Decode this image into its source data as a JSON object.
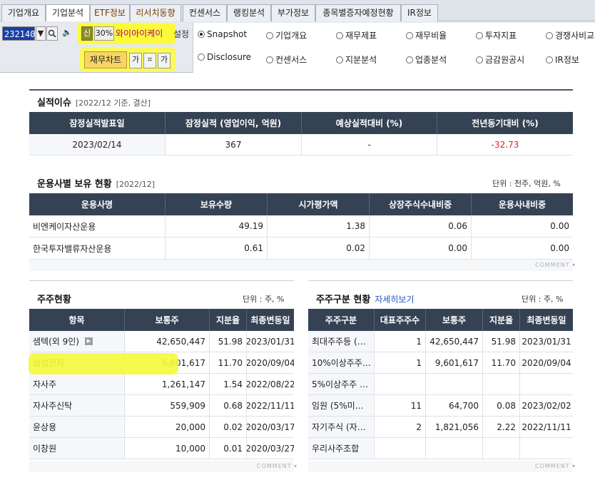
{
  "tabs": [
    {
      "label": "기업개요"
    },
    {
      "label": "기업분석"
    },
    {
      "label": "ETF정보"
    },
    {
      "label": "리서치동향"
    },
    {
      "label": "컨센서스"
    },
    {
      "label": "랭킹분석"
    },
    {
      "label": "부가정보"
    },
    {
      "label": "종목별증자예정현황"
    },
    {
      "label": "IR정보"
    }
  ],
  "toolbar": {
    "stock_code": "232140",
    "credit_badge": "신",
    "margin_rate": "30%",
    "stock_name": "와이아이케이",
    "settings_label": "설정",
    "finance_chart_label": "재무차트",
    "font_up_label": "가",
    "font_down_label": "가"
  },
  "radio_options": [
    {
      "label": "Snapshot",
      "selected": true
    },
    {
      "label": "기업개요",
      "selected": false
    },
    {
      "label": "재무제표",
      "selected": false
    },
    {
      "label": "재무비율",
      "selected": false
    },
    {
      "label": "투자지표",
      "selected": false
    },
    {
      "label": "경쟁사비교",
      "selected": false
    },
    {
      "label": "Disclosure",
      "selected": false
    },
    {
      "label": "컨센서스",
      "selected": false
    },
    {
      "label": "지분분석",
      "selected": false
    },
    {
      "label": "업종분석",
      "selected": false
    },
    {
      "label": "금감원공시",
      "selected": false
    },
    {
      "label": "IR정보",
      "selected": false
    }
  ],
  "earnings": {
    "title": "실적이슈",
    "subtitle": "[2022/12 기준, 결산]",
    "headers": [
      "잠정실적발표일",
      "잠정실적 (영업이익, 억원)",
      "예상실적대비 (%)",
      "전년동기대비 (%)"
    ],
    "row": [
      "2023/02/14",
      "367",
      "-",
      "-32.73"
    ]
  },
  "fund_holdings": {
    "title": "운용사별 보유 현황",
    "subtitle": "[2022/12]",
    "unit": "단위 : 천주, 억원, %",
    "headers": [
      "운용사명",
      "보유수량",
      "시가평가액",
      "상장주식수내비중",
      "운용사내비중"
    ],
    "rows": [
      [
        "비엔케이자산운용",
        "49.19",
        "1.38",
        "0.06",
        "0.00"
      ],
      [
        "한국투자밸류자산운용",
        "0.61",
        "0.02",
        "0.00",
        "0.00"
      ]
    ],
    "comment": "COMMENT"
  },
  "shareholders": {
    "title": "주주현황",
    "unit": "단위 : 주, %",
    "headers": [
      "항목",
      "보통주",
      "지분율",
      "최종변동일"
    ],
    "rows": [
      [
        "샘텍(외 9인)",
        "42,650,447",
        "51.98",
        "2023/01/31"
      ],
      [
        "삼성전자",
        "9,601,617",
        "11.70",
        "2020/09/04"
      ],
      [
        "자사주",
        "1,261,147",
        "1.54",
        "2022/08/22"
      ],
      [
        "자사주신탁",
        "559,909",
        "0.68",
        "2022/11/11"
      ],
      [
        "윤상용",
        "20,000",
        "0.02",
        "2020/03/17"
      ],
      [
        "이창원",
        "10,000",
        "0.01",
        "2020/03/27"
      ]
    ],
    "comment": "COMMENT"
  },
  "shareholder_types": {
    "title": "주주구분 현황",
    "detail_link": "자세히보기",
    "unit": "단위 : 주, %",
    "headers": [
      "주주구분",
      "대표주주수",
      "보통주",
      "지분율",
      "최종변동일"
    ],
    "rows": [
      [
        "최대주주등 (…",
        "1",
        "42,650,447",
        "51.98",
        "2023/01/31"
      ],
      [
        "10%이상주주…",
        "1",
        "9,601,617",
        "11.70",
        "2020/09/04"
      ],
      [
        "5%이상주주 …",
        "",
        "",
        "",
        ""
      ],
      [
        "임원 (5%미…",
        "11",
        "64,700",
        "0.08",
        "2023/02/02"
      ],
      [
        "자기주식 (자…",
        "2",
        "1,821,056",
        "2.22",
        "2022/11/11"
      ],
      [
        "우리사주조합",
        "",
        "",
        "",
        ""
      ]
    ],
    "comment": "COMMENT"
  },
  "colors": {
    "header_bg": "#354254",
    "negative": "#e0202a",
    "highlight": "#f6f83a",
    "link": "#1f56c6"
  }
}
